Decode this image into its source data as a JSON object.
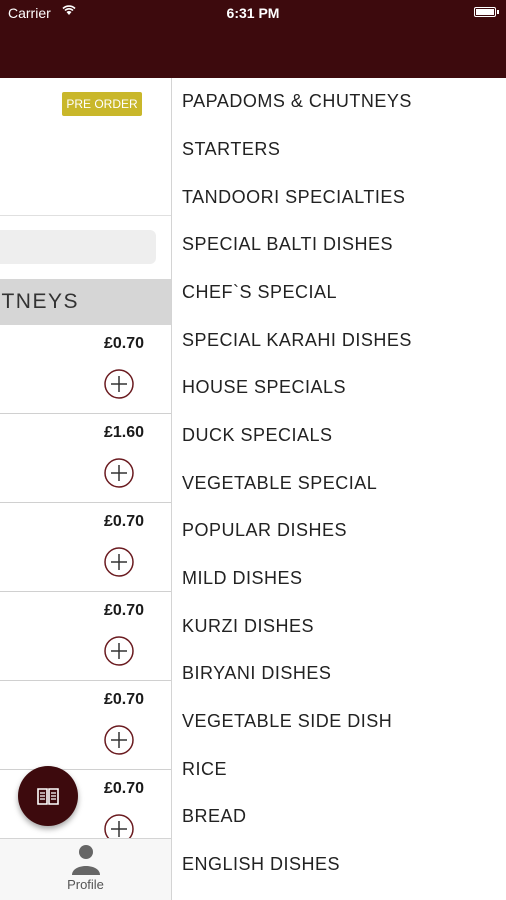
{
  "status_bar": {
    "carrier": "Carrier",
    "time": "6:31 PM"
  },
  "colors": {
    "brand": "#3d0a0d",
    "pre_order_badge": "#c9b72a",
    "category_header_bg": "#d6d6d6"
  },
  "menu": {
    "pre_order_label": "PRE ORDER",
    "category_header": "PAPADOMS & CHUTNEYS",
    "category_header_visible": "TNEYS",
    "items": [
      {
        "price": "£0.70"
      },
      {
        "price": "£1.60"
      },
      {
        "price": "£0.70"
      },
      {
        "price": "£0.70"
      },
      {
        "price": "£0.70"
      },
      {
        "price": "£0.70"
      }
    ]
  },
  "tab_bar": {
    "profile_label": "Profile"
  },
  "drawer": {
    "categories": [
      "PAPADOMS & CHUTNEYS",
      "STARTERS",
      "TANDOORI SPECIALTIES",
      "SPECIAL BALTI DISHES",
      "CHEF`S SPECIAL",
      "SPECIAL KARAHI DISHES",
      "HOUSE SPECIALS",
      "DUCK SPECIALS",
      "VEGETABLE SPECIAL",
      "POPULAR DISHES",
      "MILD DISHES",
      "KURZI DISHES",
      "BIRYANI DISHES",
      "VEGETABLE SIDE DISH",
      "RICE",
      "BREAD",
      "ENGLISH DISHES"
    ]
  }
}
